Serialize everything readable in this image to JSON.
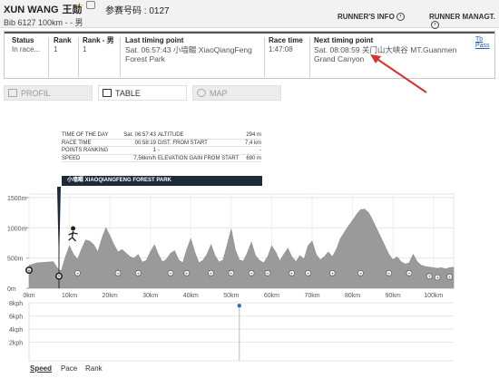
{
  "runner": {
    "name": "XUN WANG",
    "name_cn": "王勋",
    "bib_cn": "参赛号码 : 0127",
    "subline": "Bib 6127  100km - - 男"
  },
  "nav": {
    "runners_info": "RUNNER'S INFO",
    "runner_manage": "RUNNER MANAGT."
  },
  "info": {
    "status_h": "Status",
    "status_v": "In race...",
    "rank_h": "Rank",
    "rank_v": "1",
    "rank_g_h": "Rank - 男",
    "rank_g_v": "1",
    "last_h": "Last timing point",
    "last_v1": "Sat. 06:57:43  小墙畷 XiaoQiangFeng",
    "last_v2": "Forest Park",
    "racetime_h": "Race time",
    "racetime_v": "1:47:08",
    "next_h": "Next timing point",
    "next_v1": "Sat. 08:08:59  关门山大峡谷 MT.Guanmen",
    "next_v2": "Grand Canyon",
    "tbpass": "Tb Pass"
  },
  "tabs": {
    "profil": "PROFIL",
    "table": "TABLE",
    "map": "MAP"
  },
  "legend": {
    "rows": [
      {
        "l": "TIME OF THE DAY",
        "m": "Sat. 06:57:43",
        "r": "ALTITUDE",
        "rv": "294 m"
      },
      {
        "l": "RACE TIME",
        "m": "00:58:19",
        "r": "DIST. FROM START",
        "rv": "7,4 km"
      },
      {
        "l": "POINTS RANKING",
        "m": "1",
        "r": "-",
        "rv": "-"
      },
      {
        "l": "SPEED",
        "m": "7,56km/h",
        "r": "ELEVATION GAIN FROM START",
        "rv": "690 m"
      }
    ],
    "banner": "小墙畷 XIAOQIANGFENG FOREST PARK"
  },
  "chart_data": [
    {
      "type": "area",
      "ylabel": "",
      "yticks": [
        "1500m",
        "1000m",
        "500m",
        "0m"
      ],
      "xticks": [
        "0km",
        "10km",
        "20km",
        "30km",
        "40km",
        "50km",
        "60km",
        "70km",
        "80km",
        "90km",
        "100km"
      ],
      "ylim": [
        0,
        1500
      ],
      "xlim": [
        0,
        105
      ],
      "grid": true,
      "color": "#9a9a9a",
      "x": [
        0,
        2,
        4,
        6,
        7.4,
        8,
        9,
        10,
        11,
        12,
        13,
        14,
        15,
        16,
        17,
        18,
        19,
        20,
        21,
        22,
        23,
        24,
        25,
        26,
        27,
        28,
        29,
        30,
        31,
        32,
        33,
        34,
        35,
        36,
        37,
        38,
        39,
        40,
        41,
        42,
        43,
        44,
        45,
        46,
        47,
        48,
        49,
        50,
        51,
        52,
        53,
        54,
        55,
        56,
        57,
        58,
        59,
        60,
        61,
        62,
        63,
        64,
        65,
        66,
        67,
        68,
        69,
        70,
        71,
        72,
        73,
        74,
        75,
        76,
        77,
        78,
        79,
        80,
        81,
        82,
        83,
        84,
        85,
        86,
        87,
        88,
        89,
        90,
        91,
        92,
        93,
        94,
        95,
        96,
        97,
        98,
        99,
        100,
        101,
        102,
        103,
        104,
        105
      ],
      "y": [
        380,
        420,
        430,
        440,
        294,
        300,
        520,
        700,
        560,
        480,
        650,
        800,
        780,
        720,
        600,
        820,
        1000,
        870,
        720,
        600,
        640,
        580,
        520,
        500,
        560,
        430,
        460,
        600,
        720,
        560,
        430,
        480,
        580,
        620,
        470,
        420,
        640,
        820,
        600,
        420,
        460,
        560,
        720,
        540,
        430,
        470,
        720,
        980,
        640,
        470,
        450,
        590,
        760,
        540,
        460,
        420,
        520,
        700,
        600,
        450,
        560,
        660,
        520,
        440,
        540,
        480,
        700,
        780,
        560,
        470,
        520,
        600,
        520,
        640,
        820,
        930,
        1030,
        1120,
        1220,
        1300,
        1310,
        1250,
        1120,
        980,
        840,
        700,
        560,
        470,
        520,
        440,
        400,
        420,
        560,
        440,
        380,
        360,
        350,
        340,
        330,
        340,
        320,
        340,
        350
      ],
      "markers_x": [
        0,
        7.4,
        12,
        22,
        27,
        35,
        39,
        45,
        50,
        55,
        59,
        65,
        69,
        75,
        82,
        89,
        94,
        99,
        101,
        104
      ]
    },
    {
      "type": "line",
      "ylabel": "",
      "yticks": [
        "8kph",
        "6kph",
        "4kph",
        "2kph"
      ],
      "ylim": [
        0,
        8
      ],
      "x": [
        52
      ],
      "y": [
        7.56
      ],
      "grid": true
    }
  ],
  "speed_tabs": {
    "speed": "Speed",
    "pace": "Pace",
    "rank": "Rank"
  }
}
